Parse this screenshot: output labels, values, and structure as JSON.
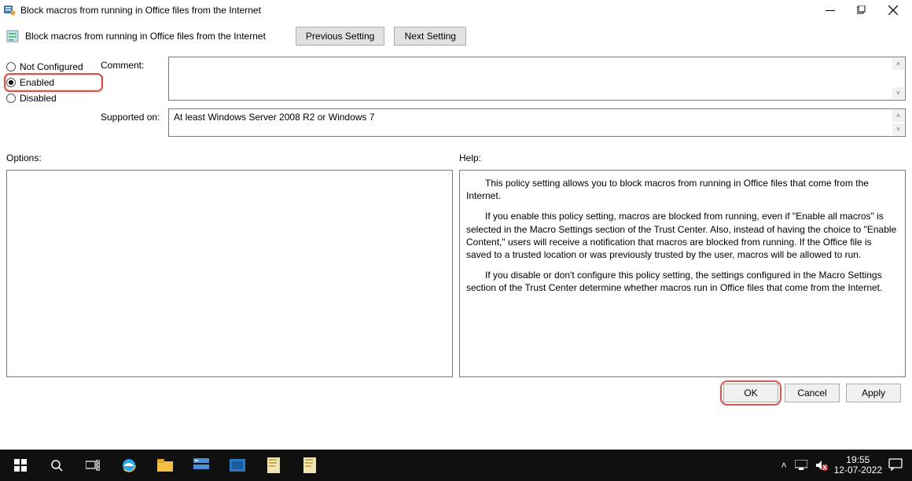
{
  "window": {
    "title": "Block macros from running in Office files from the Internet"
  },
  "subtitle": "Block macros from running in Office files from the Internet",
  "nav": {
    "previous": "Previous Setting",
    "next": "Next Setting"
  },
  "radios": {
    "not_configured": "Not Configured",
    "enabled": "Enabled",
    "disabled": "Disabled",
    "selected": "enabled"
  },
  "labels": {
    "comment": "Comment:",
    "supported": "Supported on:",
    "options": "Options:",
    "help": "Help:"
  },
  "fields": {
    "comment_value": "",
    "supported_value": "At least Windows Server 2008 R2 or Windows 7"
  },
  "help": {
    "p1": "This policy setting allows you to block macros from running in Office files that come from the Internet.",
    "p2": "If you enable this policy setting, macros are blocked from running, even if \"Enable all macros\" is selected in the Macro Settings section of the Trust Center. Also, instead of having the choice to \"Enable Content,\" users will receive a notification that macros are blocked from running. If the Office file is saved to a trusted location or was previously trusted by the user, macros will be allowed to run.",
    "p3": "If you disable or don't configure this policy setting, the settings configured in the Macro Settings section of the Trust Center determine whether macros run in Office files that come from the Internet."
  },
  "buttons": {
    "ok": "OK",
    "cancel": "Cancel",
    "apply": "Apply"
  },
  "taskbar": {
    "time": "19:55",
    "date": "12-07-2022"
  }
}
